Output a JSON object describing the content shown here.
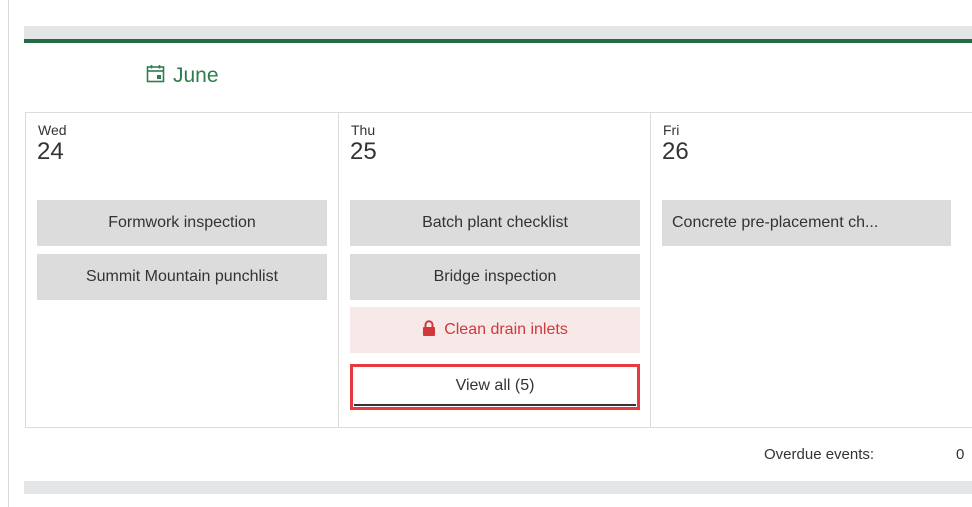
{
  "calendar": {
    "month": "June",
    "colors": {
      "accent_green": "#226b44",
      "month_text": "#2f7d4f",
      "lock_red": "#d0383c",
      "highlight_border": "#e53a3f"
    },
    "days": [
      {
        "dow": "Wed",
        "date": "24",
        "events": [
          "Formwork inspection",
          "Summit Mountain punchlist"
        ]
      },
      {
        "dow": "Thu",
        "date": "25",
        "events": [
          "Batch plant checklist",
          "Bridge inspection"
        ],
        "locked_event": "Clean drain inlets",
        "view_all": "View all (5)"
      },
      {
        "dow": "Fri",
        "date": "26",
        "events": [
          "Concrete pre-placement ch..."
        ]
      }
    ]
  },
  "footer": {
    "overdue_label": "Overdue events:",
    "overdue_count": "0"
  },
  "icons": {
    "month": "calendar-icon",
    "locked": "lock-icon"
  }
}
